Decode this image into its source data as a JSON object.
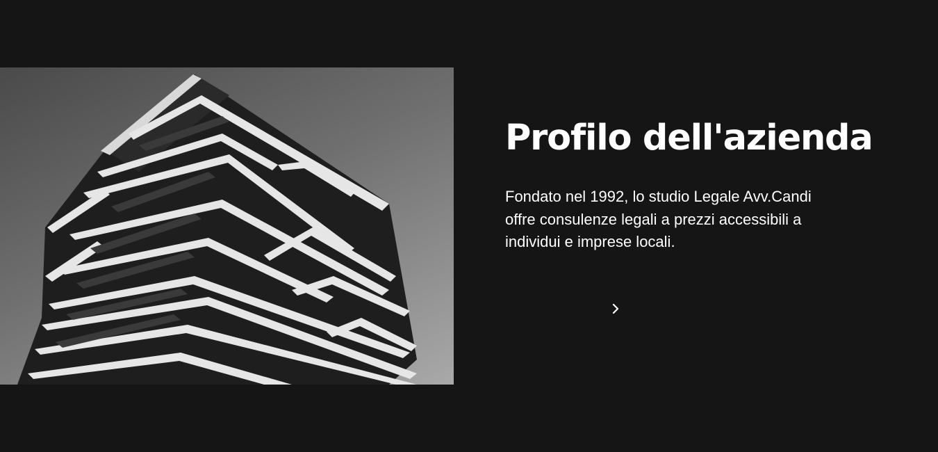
{
  "profile": {
    "title": "Profilo dell'azienda",
    "description": "Fondato nel 1992, lo studio Legale Avv.Candi offre consulenze legali a prezzi accessibili a individui e imprese locali."
  },
  "icons": {
    "next": "chevron-right-icon"
  },
  "colors": {
    "background": "#151515",
    "text": "#ffffff"
  }
}
